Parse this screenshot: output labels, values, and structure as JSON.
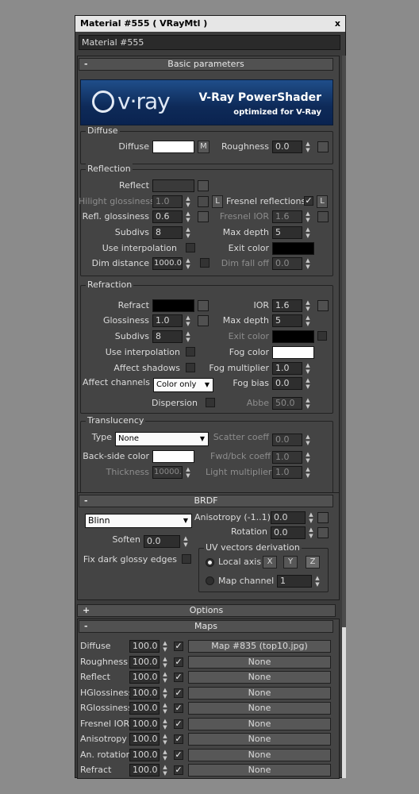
{
  "window": {
    "title": "Material #555  ( VRayMtl )",
    "close": "x",
    "material_name": "Material #555"
  },
  "basic": {
    "header": "Basic parameters",
    "toggle": "-",
    "banner_logo": "v·ray",
    "banner_title": "V-Ray PowerShader",
    "banner_sub": "optimized for V-Ray"
  },
  "diffuse": {
    "title": "Diffuse",
    "diffuse_label": "Diffuse",
    "m_btn": "M",
    "roughness_label": "Roughness",
    "roughness": "0.0"
  },
  "reflection": {
    "title": "Reflection",
    "reflect_label": "Reflect",
    "hilight_label": "Hilight glossiness",
    "hilight": "1.0",
    "l_btn": "L",
    "fresnel_label": "Fresnel reflections",
    "refl_gloss_label": "Refl. glossiness",
    "refl_gloss": "0.6",
    "fresnel_ior_label": "Fresnel IOR",
    "fresnel_ior": "1.6",
    "subdivs_label": "Subdivs",
    "subdivs": "8",
    "max_depth_label": "Max depth",
    "max_depth": "5",
    "use_interp_label": "Use interpolation",
    "exit_color_label": "Exit color",
    "dim_dist_label": "Dim distance",
    "dim_dist": "1000.0",
    "dim_falloff_label": "Dim fall off",
    "dim_falloff": "0.0"
  },
  "refraction": {
    "title": "Refraction",
    "refract_label": "Refract",
    "ior_label": "IOR",
    "ior": "1.6",
    "gloss_label": "Glossiness",
    "gloss": "1.0",
    "max_depth_label": "Max depth",
    "max_depth": "5",
    "subdivs_label": "Subdivs",
    "subdivs": "8",
    "exit_color_label": "Exit color",
    "use_interp_label": "Use interpolation",
    "fog_color_label": "Fog color",
    "affect_shadows_label": "Affect shadows",
    "fog_mult_label": "Fog multiplier",
    "fog_mult": "1.0",
    "affect_channels_label": "Affect channels",
    "affect_channels": "Color only",
    "fog_bias_label": "Fog bias",
    "fog_bias": "0.0",
    "dispersion_label": "Dispersion",
    "abbe_label": "Abbe",
    "abbe": "50.0"
  },
  "translucency": {
    "title": "Translucency",
    "type_label": "Type",
    "type": "None",
    "scatter_label": "Scatter coeff",
    "scatter": "0.0",
    "backside_label": "Back-side color",
    "fwdbck_label": "Fwd/bck coeff",
    "fwdbck": "1.0",
    "thickness_label": "Thickness",
    "thickness": "10000.",
    "light_mult_label": "Light multiplier",
    "light_mult": "1.0"
  },
  "brdf": {
    "header": "BRDF",
    "toggle": "-",
    "type": "Blinn",
    "aniso_label": "Anisotropy (-1..1)",
    "aniso": "0.0",
    "rotation_label": "Rotation",
    "rotation": "0.0",
    "soften_label": "Soften",
    "soften": "0.0",
    "fix_dark_label": "Fix dark glossy edges",
    "uv_title": "UV vectors derivation",
    "local_axis_label": "Local axis",
    "x": "X",
    "y": "Y",
    "z": "Z",
    "map_channel_label": "Map channel",
    "map_channel": "1"
  },
  "options": {
    "header": "Options",
    "toggle": "+"
  },
  "maps": {
    "header": "Maps",
    "toggle": "-",
    "rows": [
      {
        "name": "Diffuse",
        "amount": "100.0",
        "map": "Map #835 (top10.jpg)"
      },
      {
        "name": "Roughness",
        "amount": "100.0",
        "map": "None"
      },
      {
        "name": "Reflect",
        "amount": "100.0",
        "map": "None"
      },
      {
        "name": "HGlossiness",
        "amount": "100.0",
        "map": "None"
      },
      {
        "name": "RGlossiness",
        "amount": "100.0",
        "map": "None"
      },
      {
        "name": "Fresnel IOR",
        "amount": "100.0",
        "map": "None"
      },
      {
        "name": "Anisotropy",
        "amount": "100.0",
        "map": "None"
      },
      {
        "name": "An. rotation",
        "amount": "100.0",
        "map": "None"
      },
      {
        "name": "Refract",
        "amount": "100.0",
        "map": "None"
      }
    ]
  },
  "colors": {
    "diffuse": "#ffffff",
    "reflect": "#3a3a3a",
    "exit_refl": "#000000",
    "refract": "#000000",
    "exit_refr": "#000000",
    "fog": "#ffffff",
    "backside": "#ffffff"
  }
}
